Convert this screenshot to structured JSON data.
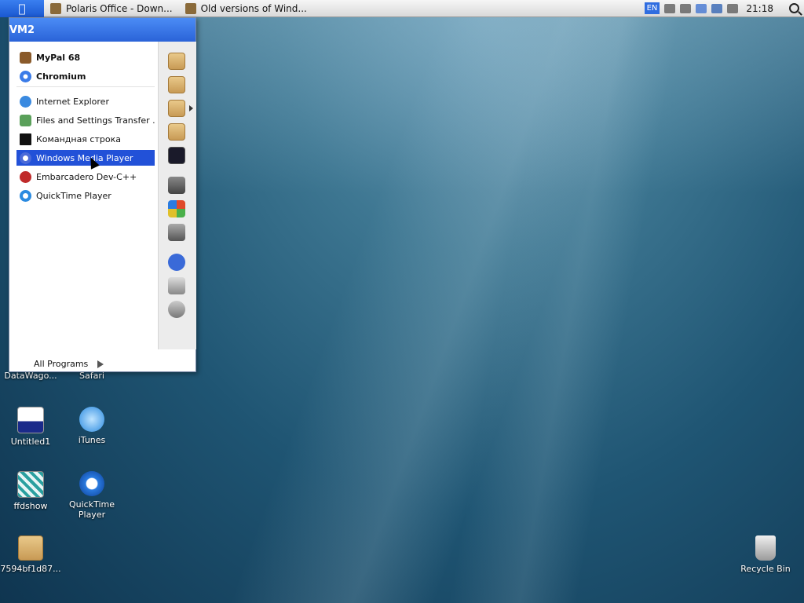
{
  "menubar": {
    "tasks": [
      {
        "label": "Polaris Office - Down..."
      },
      {
        "label": "Old versions of Wind..."
      }
    ],
    "lang": "EN",
    "clock": "21:18"
  },
  "start_menu": {
    "header": "VM2",
    "pinned": [
      {
        "label": "MyPal 68"
      },
      {
        "label": "Chromium"
      }
    ],
    "recent": [
      {
        "label": "Internet Explorer"
      },
      {
        "label": "Files and Settings Transfer ..."
      },
      {
        "label": "Командная строка"
      },
      {
        "label": "Windows Media Player"
      },
      {
        "label": "Embarcadero Dev-C++"
      },
      {
        "label": "QuickTime Player"
      }
    ],
    "all_programs": "All Programs"
  },
  "desktop": {
    "icons": [
      {
        "label": "DataWago..."
      },
      {
        "label": "Safari"
      },
      {
        "label": "Untitled1"
      },
      {
        "label": "iTunes"
      },
      {
        "label": "ffdshow"
      },
      {
        "label": "QuickTime Player"
      },
      {
        "label": "7594bf1d87..."
      },
      {
        "label": "Recycle Bin"
      }
    ]
  },
  "colors": {
    "accent": "#2251d8",
    "menu_header": "#3a78e8"
  }
}
